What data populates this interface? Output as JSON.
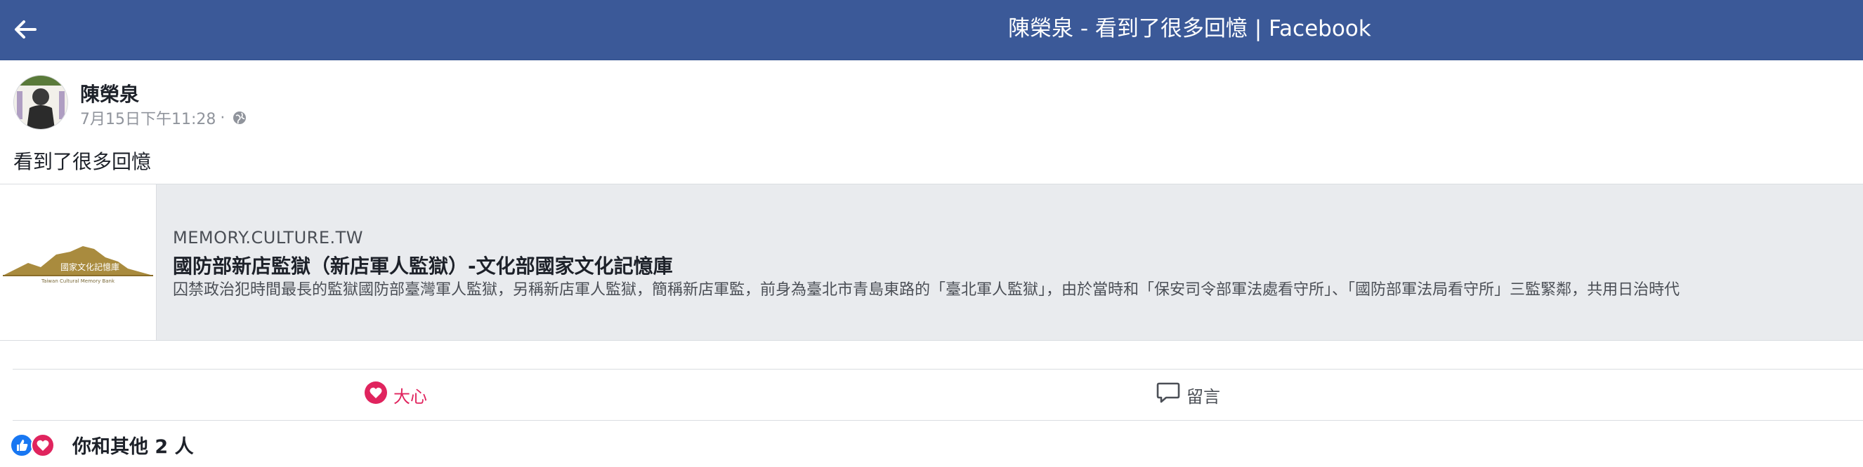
{
  "header": {
    "title": "陳榮泉 - 看到了很多回憶 | Facebook"
  },
  "post": {
    "author": "陳榮泉",
    "timestamp": "7月15日下午11:28",
    "separator": "·",
    "text": "看到了很多回憶",
    "privacy_icon": "globe-icon"
  },
  "link_preview": {
    "domain": "MEMORY.CULTURE.TW",
    "title": "國防部新店監獄（新店軍人監獄）-文化部國家文化記憶庫",
    "description": "囚禁政治犯時間最長的監獄國防部臺灣軍人監獄，另稱新店軍人監獄，簡稱新店軍監，前身為臺北市青島東路的「臺北軍人監獄」，由於當時和「保安司令部軍法處看守所」、「國防部軍法局看守所」三監緊鄰，共用日治時代",
    "thumb_caption": "國家文化記憶庫"
  },
  "actions": {
    "love_label": "大心",
    "comment_label": "留言"
  },
  "reactions": {
    "summary": "你和其他 2 人"
  },
  "colors": {
    "brand_bar": "#3b5998",
    "love": "#e0245e",
    "like": "#1877f2",
    "link_bg": "#e9ebee"
  }
}
